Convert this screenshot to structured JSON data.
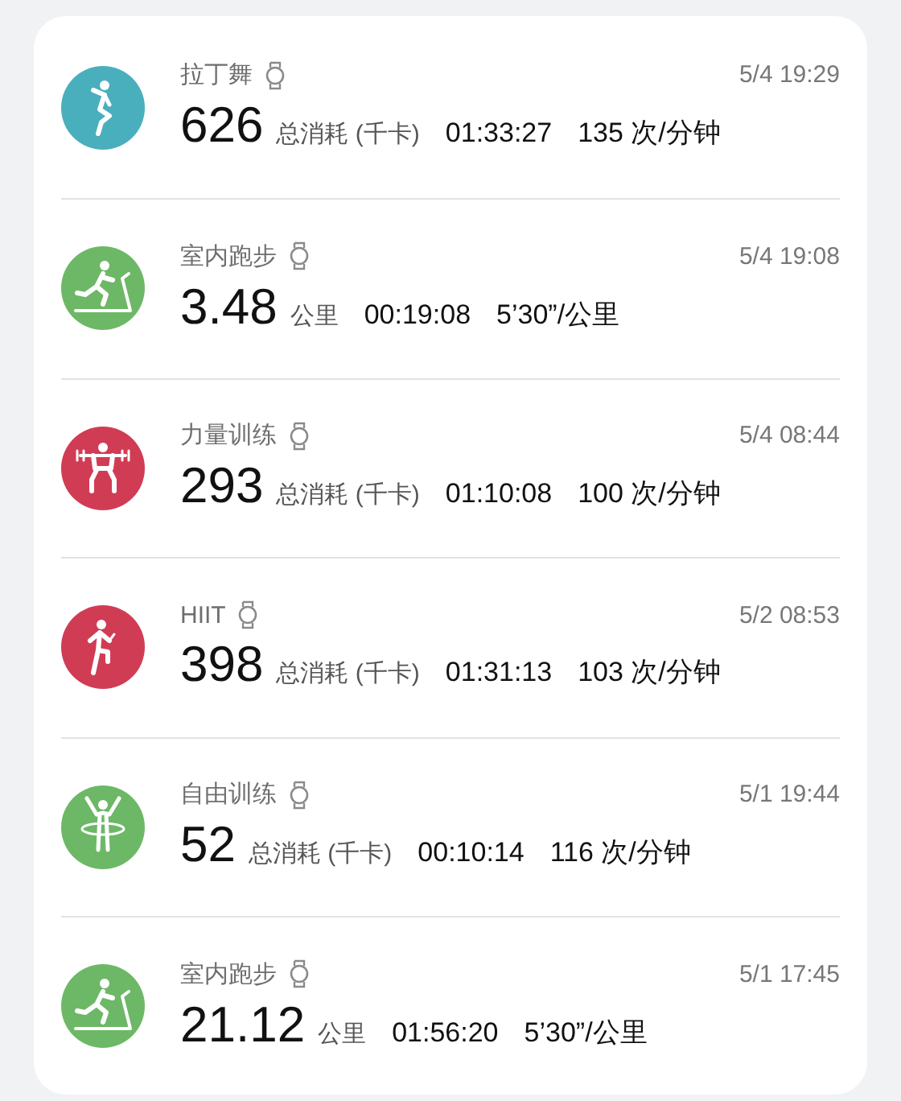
{
  "workouts": [
    {
      "kind": "dance",
      "color": "#4aafbd",
      "name": "拉丁舞",
      "time": "5/4 19:29",
      "value": "626",
      "unit": "总消耗 (千卡)",
      "duration": "01:33:27",
      "rate": "135 次/分钟"
    },
    {
      "kind": "treadmill",
      "color": "#6db866",
      "name": "室内跑步",
      "time": "5/4 19:08",
      "value": "3.48",
      "unit": "公里",
      "duration": "00:19:08",
      "rate": "5’30”/公里"
    },
    {
      "kind": "weights",
      "color": "#d13c55",
      "name": "力量训练",
      "time": "5/4 08:44",
      "value": "293",
      "unit": "总消耗 (千卡)",
      "duration": "01:10:08",
      "rate": "100 次/分钟"
    },
    {
      "kind": "hiit",
      "color": "#d13c55",
      "name": "HIIT",
      "time": "5/2 08:53",
      "value": "398",
      "unit": "总消耗 (千卡)",
      "duration": "01:31:13",
      "rate": "103 次/分钟"
    },
    {
      "kind": "free",
      "color": "#6db866",
      "name": "自由训练",
      "time": "5/1 19:44",
      "value": "52",
      "unit": "总消耗 (千卡)",
      "duration": "00:10:14",
      "rate": "116 次/分钟"
    },
    {
      "kind": "treadmill",
      "color": "#6db866",
      "name": "室内跑步",
      "time": "5/1 17:45",
      "value": "21.12",
      "unit": "公里",
      "duration": "01:56:20",
      "rate": "5’30”/公里"
    }
  ]
}
